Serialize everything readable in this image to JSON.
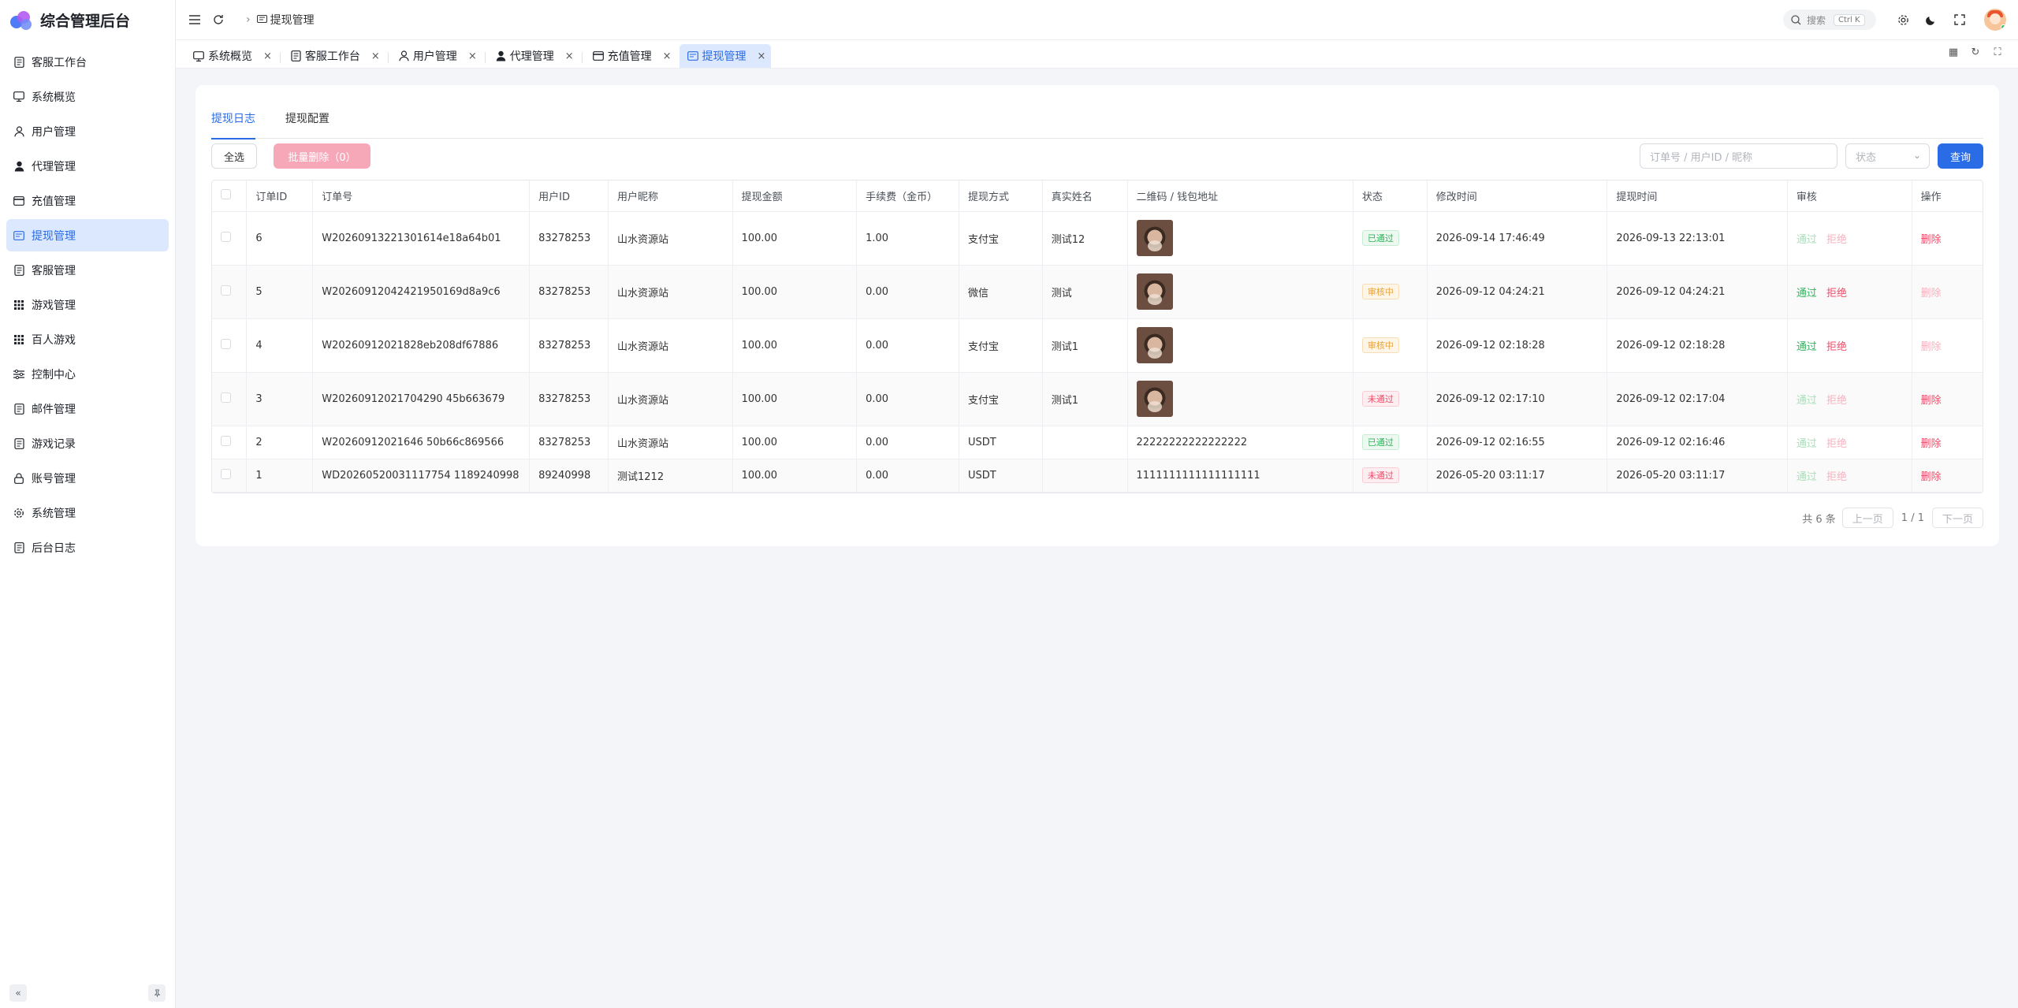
{
  "app": {
    "title": "综合管理后台"
  },
  "sidebar": {
    "items": [
      {
        "label": "客服工作台",
        "icon": "doc-icon"
      },
      {
        "label": "系统概览",
        "icon": "dashboard-icon"
      },
      {
        "label": "用户管理",
        "icon": "user-icon"
      },
      {
        "label": "代理管理",
        "icon": "user-filled-icon"
      },
      {
        "label": "充值管理",
        "icon": "card-icon"
      },
      {
        "label": "提现管理",
        "icon": "withdraw-icon",
        "active": true
      },
      {
        "label": "客服管理",
        "icon": "doc-icon"
      },
      {
        "label": "游戏管理",
        "icon": "grid-icon"
      },
      {
        "label": "百人游戏",
        "icon": "grid-icon"
      },
      {
        "label": "控制中心",
        "icon": "sliders-icon"
      },
      {
        "label": "邮件管理",
        "icon": "doc-icon"
      },
      {
        "label": "游戏记录",
        "icon": "doc-icon"
      },
      {
        "label": "账号管理",
        "icon": "lock-icon"
      },
      {
        "label": "系统管理",
        "icon": "gear-icon"
      },
      {
        "label": "后台日志",
        "icon": "doc-icon"
      }
    ]
  },
  "header": {
    "breadcrumb": "提现管理",
    "search_placeholder": "搜索",
    "search_shortcut": "Ctrl K"
  },
  "tabs": [
    {
      "label": "系统概览"
    },
    {
      "label": "客服工作台"
    },
    {
      "label": "用户管理"
    },
    {
      "label": "代理管理"
    },
    {
      "label": "充值管理"
    },
    {
      "label": "提现管理",
      "active": true
    }
  ],
  "page": {
    "subtabs": [
      "提现日志",
      "提现配置"
    ],
    "select_all_label": "全选",
    "batch_delete_label": "批量删除（0）",
    "filter_placeholder": "订单号 / 用户ID / 昵称",
    "status_placeholder": "状态",
    "query_label": "查询"
  },
  "table": {
    "columns": [
      "订单ID",
      "订单号",
      "用户ID",
      "用户昵称",
      "提现金额",
      "手续费（金币）",
      "提现方式",
      "真实姓名",
      "二维码 / 钱包地址",
      "状态",
      "修改时间",
      "提现时间",
      "审核",
      "操作"
    ],
    "rows": [
      {
        "id": "6",
        "order_no": "W20260913221301614e18a64b01",
        "user_id": "83278253",
        "nickname": "山水资源站",
        "amount": "100.00",
        "fee": "1.00",
        "method": "支付宝",
        "real_name": "测试12",
        "qr": true,
        "wallet": "",
        "status": "已通过",
        "status_type": "ok",
        "modified": "2026-09-14 17:46:49",
        "time": "2026-09-13 22:13:01",
        "pass": "通过",
        "reject": "拒绝",
        "delete": "删除",
        "review_dim": true,
        "delete_dim": false
      },
      {
        "id": "5",
        "order_no": "W20260912042421950169d8a9c6",
        "user_id": "83278253",
        "nickname": "山水资源站",
        "amount": "100.00",
        "fee": "0.00",
        "method": "微信",
        "real_name": "测试",
        "qr": true,
        "wallet": "",
        "status": "审核中",
        "status_type": "wait",
        "modified": "2026-09-12 04:24:21",
        "time": "2026-09-12 04:24:21",
        "pass": "通过",
        "reject": "拒绝",
        "delete": "删除",
        "review_dim": false,
        "delete_dim": true
      },
      {
        "id": "4",
        "order_no": "W20260912021828eb208df67886",
        "user_id": "83278253",
        "nickname": "山水资源站",
        "amount": "100.00",
        "fee": "0.00",
        "method": "支付宝",
        "real_name": "测试1",
        "qr": true,
        "wallet": "",
        "status": "审核中",
        "status_type": "wait",
        "modified": "2026-09-12 02:18:28",
        "time": "2026-09-12 02:18:28",
        "pass": "通过",
        "reject": "拒绝",
        "delete": "删除",
        "review_dim": false,
        "delete_dim": true
      },
      {
        "id": "3",
        "order_no": "W20260912021704290 45b663679",
        "user_id": "83278253",
        "nickname": "山水资源站",
        "amount": "100.00",
        "fee": "0.00",
        "method": "支付宝",
        "real_name": "测试1",
        "qr": true,
        "wallet": "",
        "status": "未通过",
        "status_type": "no",
        "modified": "2026-09-12 02:17:10",
        "time": "2026-09-12 02:17:04",
        "pass": "通过",
        "reject": "拒绝",
        "delete": "删除",
        "review_dim": true,
        "delete_dim": false
      },
      {
        "id": "2",
        "order_no": "W20260912021646 50b66c869566",
        "user_id": "83278253",
        "nickname": "山水资源站",
        "amount": "100.00",
        "fee": "0.00",
        "method": "USDT",
        "real_name": "",
        "qr": false,
        "wallet": "22222222222222222",
        "status": "已通过",
        "status_type": "ok",
        "modified": "2026-09-12 02:16:55",
        "time": "2026-09-12 02:16:46",
        "pass": "通过",
        "reject": "拒绝",
        "delete": "删除",
        "review_dim": true,
        "delete_dim": false
      },
      {
        "id": "1",
        "order_no": "WD20260520031117754 1189240998",
        "user_id": "89240998",
        "nickname": "测试1212",
        "amount": "100.00",
        "fee": "0.00",
        "method": "USDT",
        "real_name": "",
        "qr": false,
        "wallet": "1111111111111111111",
        "status": "未通过",
        "status_type": "no",
        "modified": "2026-05-20 03:11:17",
        "time": "2026-05-20 03:11:17",
        "pass": "通过",
        "reject": "拒绝",
        "delete": "删除",
        "review_dim": true,
        "delete_dim": false
      }
    ]
  },
  "pager": {
    "total": "共 6 条",
    "prev": "上一页",
    "page": "1 / 1",
    "next": "下一页"
  }
}
